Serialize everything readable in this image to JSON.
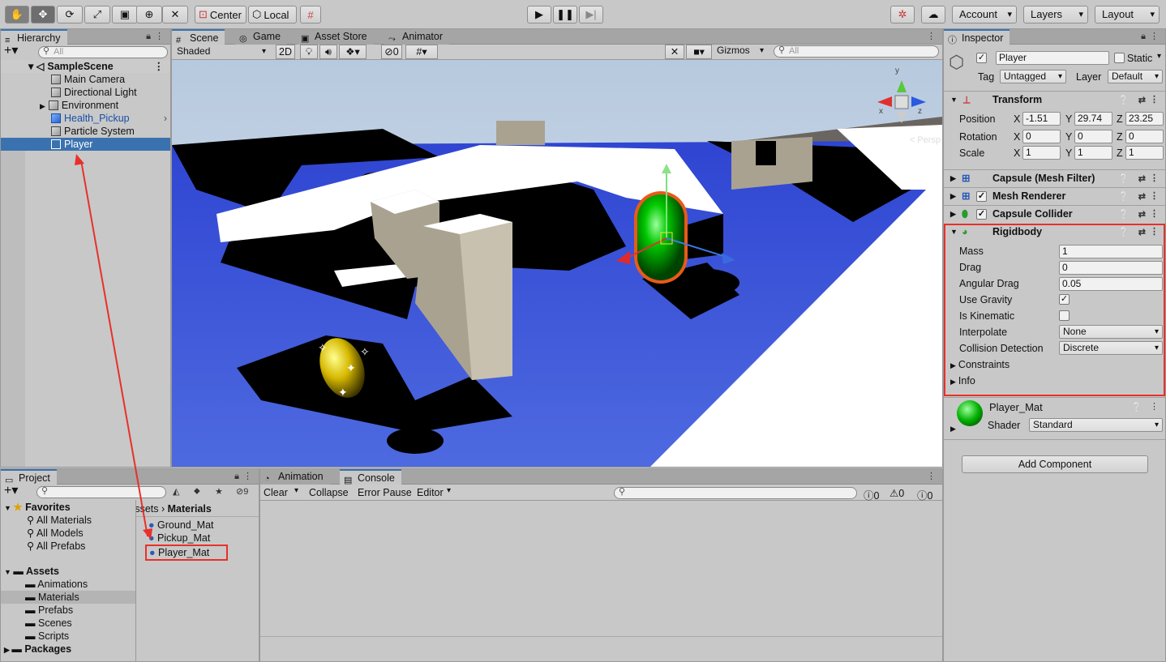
{
  "toolbar": {
    "tools": [
      "hand-tool",
      "move-tool",
      "rotate-tool",
      "scale-tool",
      "rect-tool",
      "transform-tool",
      "custom-tool"
    ],
    "center_label": "Center",
    "local_label": "Local",
    "account_label": "Account",
    "layers_label": "Layers",
    "layout_label": "Layout"
  },
  "hierarchy": {
    "tab": "Hierarchy",
    "search_placeholder": "All",
    "scene": "SampleScene",
    "items": [
      {
        "label": "Main Camera"
      },
      {
        "label": "Directional Light"
      },
      {
        "label": "Environment"
      },
      {
        "label": "Health_Pickup"
      },
      {
        "label": "Particle System"
      },
      {
        "label": "Player"
      }
    ]
  },
  "scene_view": {
    "tabs": [
      "Scene",
      "Game",
      "Asset Store",
      "Animator"
    ],
    "shading": "Shaded",
    "mode_2d": "2D",
    "hidden_count": "0",
    "gizmos": "Gizmos",
    "search_placeholder": "All",
    "persp_label": "< Persp"
  },
  "inspector": {
    "tab": "Inspector",
    "object_name": "Player",
    "static_label": "Static",
    "tag_label": "Tag",
    "tag_value": "Untagged",
    "layer_label": "Layer",
    "layer_value": "Default",
    "transform": {
      "title": "Transform",
      "position_label": "Position",
      "rotation_label": "Rotation",
      "scale_label": "Scale",
      "position": {
        "x": "-1.51",
        "y": "29.74",
        "z": "23.25"
      },
      "rotation": {
        "x": "0",
        "y": "0",
        "z": "0"
      },
      "scale": {
        "x": "1",
        "y": "1",
        "z": "1"
      }
    },
    "mesh_filter": "Capsule (Mesh Filter)",
    "mesh_renderer": "Mesh Renderer",
    "capsule_collider": "Capsule Collider",
    "rigidbody": {
      "title": "Rigidbody",
      "mass_label": "Mass",
      "mass": "1",
      "drag_label": "Drag",
      "drag": "0",
      "angular_drag_label": "Angular Drag",
      "angular_drag": "0.05",
      "use_gravity_label": "Use Gravity",
      "use_gravity": "✓",
      "is_kinematic_label": "Is Kinematic",
      "interpolate_label": "Interpolate",
      "interpolate": "None",
      "collision_label": "Collision Detection",
      "collision": "Discrete",
      "constraints_label": "Constraints",
      "info_label": "Info"
    },
    "material": {
      "name": "Player_Mat",
      "shader_label": "Shader",
      "shader": "Standard"
    },
    "add_component": "Add Component"
  },
  "project": {
    "tab": "Project",
    "hidden_count": "9",
    "favorites_label": "Favorites",
    "favorites": [
      "All Materials",
      "All Models",
      "All Prefabs"
    ],
    "assets_label": "Assets",
    "asset_folders": [
      "Animations",
      "Materials",
      "Prefabs",
      "Scenes",
      "Scripts"
    ],
    "packages_label": "Packages",
    "breadcrumb_parent": "Assets",
    "breadcrumb_current": "Materials",
    "files": [
      "Ground_Mat",
      "Pickup_Mat",
      "Player_Mat"
    ]
  },
  "console": {
    "tabs": [
      "Animation",
      "Console"
    ],
    "clear": "Clear",
    "collapse": "Collapse",
    "error_pause": "Error Pause",
    "editor": "Editor",
    "log_count": "0",
    "warn_count": "0",
    "error_count": "0"
  },
  "colors": {
    "highlight": "#e8302a",
    "selection": "#3a72b0",
    "scene_floor": "#3048d0",
    "sky": "#c8d8ec"
  }
}
